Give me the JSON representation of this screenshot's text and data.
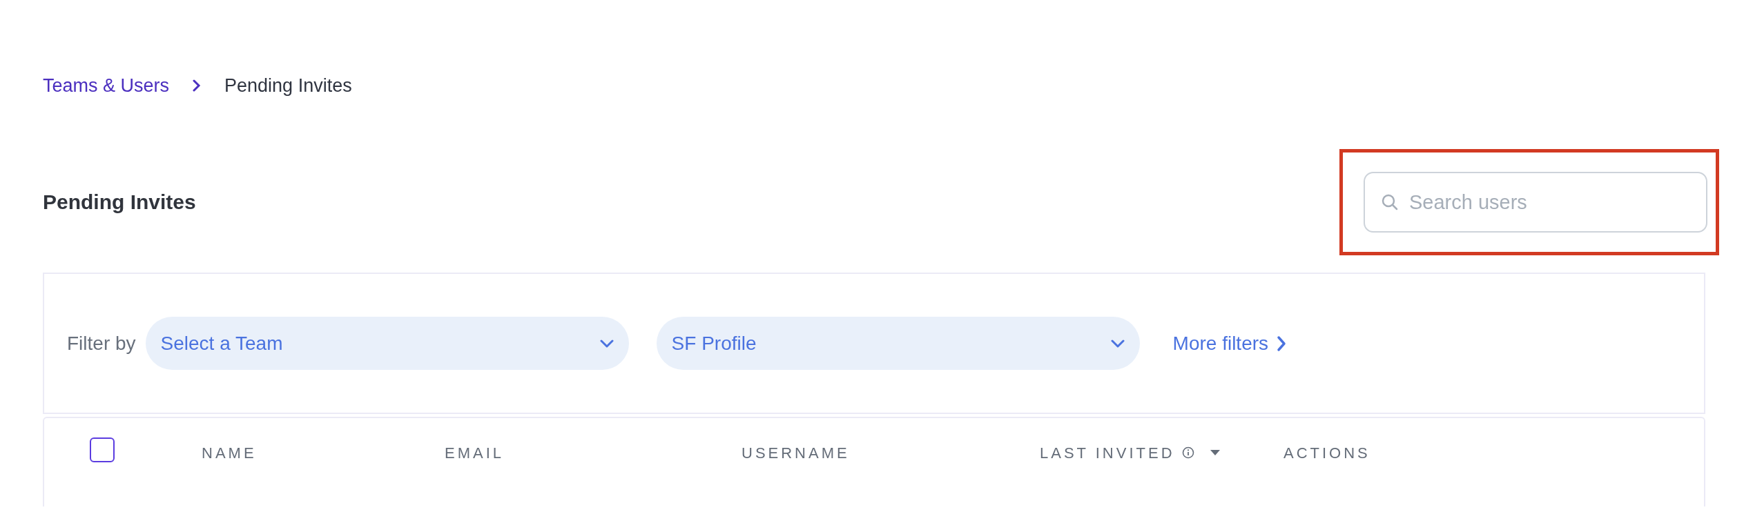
{
  "breadcrumb": [
    {
      "label": "Teams & Users",
      "kind": "link"
    },
    {
      "label": "Pending Invites",
      "kind": "current"
    }
  ],
  "title": "Pending Invites",
  "search": {
    "placeholder": "Search users",
    "highlighted": true
  },
  "filters": {
    "label": "Filter by",
    "dropdowns": [
      {
        "value": "Select a Team"
      },
      {
        "value": "SF Profile"
      }
    ],
    "more": "More filters"
  },
  "table": {
    "select_all": {
      "checked": false
    },
    "columns": [
      {
        "label": "NAME",
        "kind": "plain"
      },
      {
        "label": "EMAIL",
        "kind": "plain"
      },
      {
        "label": "USERNAME",
        "kind": "plain"
      },
      {
        "label": "LAST INVITED",
        "kind": "sortable"
      },
      {
        "label": "ACTIONS",
        "kind": "plain"
      }
    ]
  }
}
